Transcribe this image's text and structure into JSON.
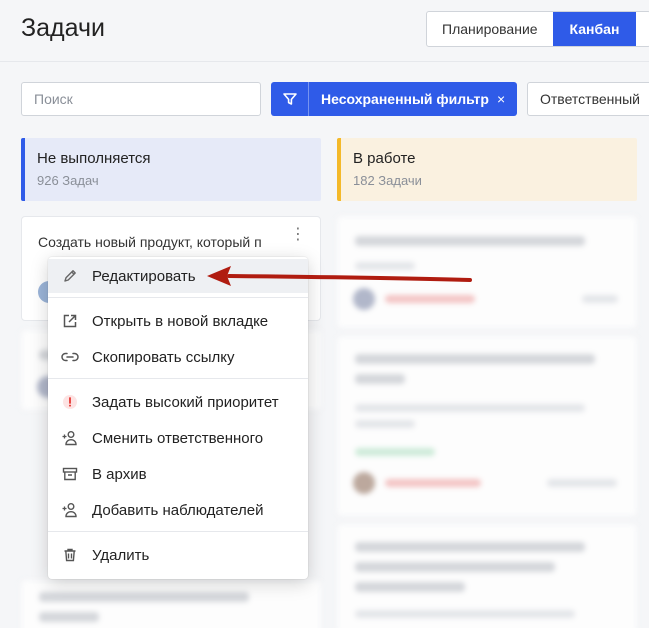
{
  "header": {
    "title": "Задачи",
    "views": [
      "Планирование",
      "Канбан"
    ],
    "active_view": "Канбан"
  },
  "toolbar": {
    "search_placeholder": "Поиск",
    "filter_label": "Несохраненный фильтр",
    "filter_close": "×",
    "responsible_label": "Ответственный"
  },
  "columns": [
    {
      "title": "Не выполняется",
      "count": "926 Задач",
      "accent": "#2f5be8"
    },
    {
      "title": "В работе",
      "count": "182 Задачи",
      "accent": "#f4b92a"
    }
  ],
  "card": {
    "title": "Создать новый продукт, который п",
    "more_icon": "kebab-icon"
  },
  "context_menu": {
    "items": [
      {
        "icon": "pencil-icon",
        "label": "Редактировать"
      },
      {
        "icon": "external-link-icon",
        "label": "Открыть в новой вкладке"
      },
      {
        "icon": "link-icon",
        "label": "Скопировать ссылку"
      },
      {
        "icon": "priority-icon",
        "label": "Задать высокий приоритет"
      },
      {
        "icon": "user-change-icon",
        "label": "Сменить ответственного"
      },
      {
        "icon": "archive-icon",
        "label": "В архив"
      },
      {
        "icon": "user-add-icon",
        "label": "Добавить наблюдателей"
      },
      {
        "icon": "trash-icon",
        "label": "Удалить"
      }
    ]
  },
  "colors": {
    "primary": "#2f5be8",
    "annotation_arrow": "#b01c10",
    "priority": "#e53935"
  }
}
